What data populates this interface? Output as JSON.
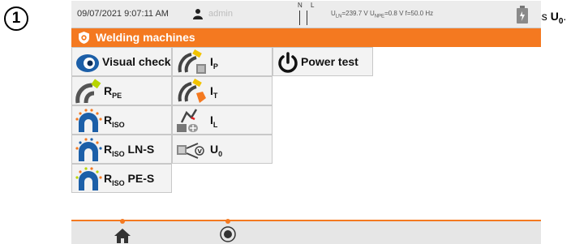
{
  "step": {
    "number": "1"
  },
  "instruction": {
    "prefix": "Press ",
    "key": "U",
    "key_sub": "0",
    "suffix": "."
  },
  "status": {
    "datetime": "09/07/2021 9:07:11 AM",
    "user": "admin",
    "nl_label": "N L",
    "u_ln": "U",
    "u_ln_sub": "LN",
    "u_ln_value": "=239.7 V ",
    "u_npe": "U",
    "u_npe_sub": "NPE",
    "u_npe_value": "=0.8 V f=50.0 Hz"
  },
  "title": {
    "text": "Welding machines"
  },
  "tiles": {
    "visual": {
      "text": "Visual check"
    },
    "ip": {
      "main": "I",
      "sub": "P"
    },
    "power": {
      "text": "Power test"
    },
    "rpe": {
      "main": "R",
      "sub": "PE"
    },
    "it": {
      "main": "I",
      "sub": "T"
    },
    "riso": {
      "main": "R",
      "sub": "ISO"
    },
    "il": {
      "main": "I",
      "sub": "L"
    },
    "riso_lns": {
      "main": "R",
      "sub": "ISO",
      "suffix": " LN-S"
    },
    "u0": {
      "main": "U",
      "sub": "0"
    },
    "riso_pes": {
      "main": "R",
      "sub": "ISO",
      "suffix": " PE-S"
    }
  },
  "colors": {
    "accent": "#f47920",
    "statusbar": "#ececec",
    "tile": "#f3f3f3"
  },
  "icons": {
    "step": "numbered-circle",
    "user": "person-icon",
    "battery": "battery-plug-icon",
    "title": "shield-icon",
    "visual": "eye-icon",
    "ip": "clamp-probe-icon",
    "power": "power-icon",
    "rpe": "continuity-probe-icon",
    "it": "clamp-hand-icon",
    "riso": "insulation-icon",
    "il": "leakage-icon",
    "u0": "voltage-probe-icon",
    "home": "home-icon",
    "record": "record-icon"
  }
}
